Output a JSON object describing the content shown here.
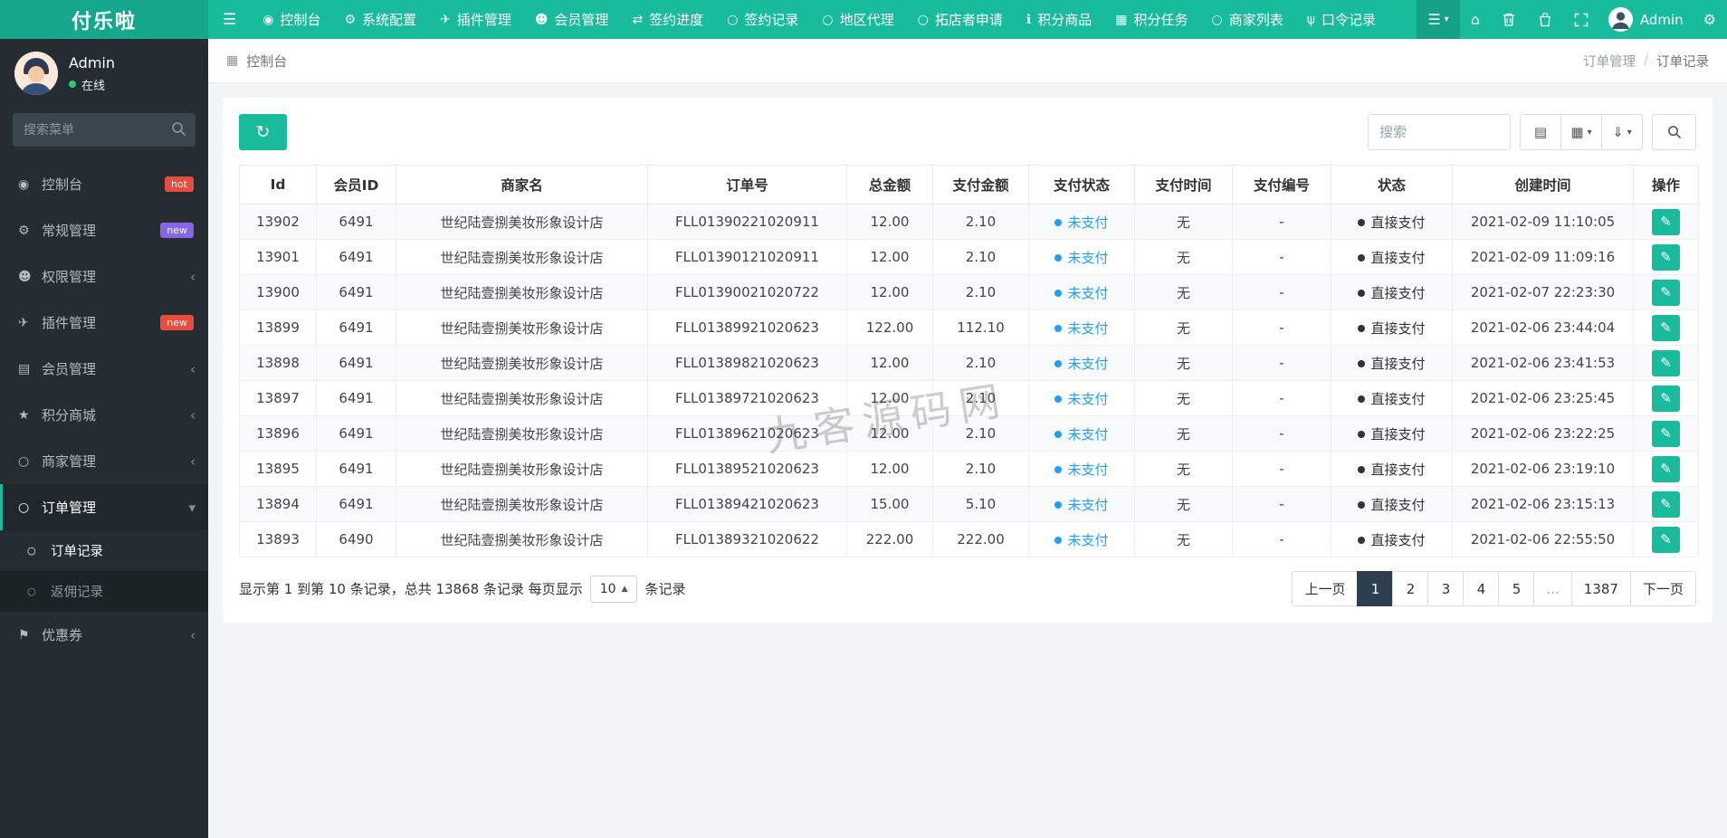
{
  "brand": {
    "logo": "付乐啦"
  },
  "colors": {
    "accent": "#18bc9c",
    "pay_status_blue": "#1e9fff",
    "status_dark": "#333333",
    "pagination_active": "#2c3e50",
    "badge_red": "#e74c3c",
    "badge_purple": "#8566e8"
  },
  "topnav": {
    "items": [
      {
        "label": "控制台",
        "icon": "dashboard-icon"
      },
      {
        "label": "系统配置",
        "icon": "gear-icon"
      },
      {
        "label": "插件管理",
        "icon": "plane-icon"
      },
      {
        "label": "会员管理",
        "icon": "users-icon"
      },
      {
        "label": "签约进度",
        "icon": "arrows-icon"
      },
      {
        "label": "签约记录",
        "icon": "circle-icon"
      },
      {
        "label": "地区代理",
        "icon": "circle-icon"
      },
      {
        "label": "拓店者申请",
        "icon": "circle-icon"
      },
      {
        "label": "积分商品",
        "icon": "info-icon"
      },
      {
        "label": "积分任务",
        "icon": "grid-icon"
      },
      {
        "label": "商家列表",
        "icon": "circle-icon"
      },
      {
        "label": "口令记录",
        "icon": "fork-icon"
      }
    ],
    "user_name": "Admin"
  },
  "sidebar": {
    "user": {
      "name": "Admin",
      "status": "在线"
    },
    "search_placeholder": "搜索菜单",
    "items": [
      {
        "label": "控制台",
        "icon": "dashboard-icon",
        "badge": "hot",
        "badge_color": "#e74c3c"
      },
      {
        "label": "常规管理",
        "icon": "gear-icon",
        "badge": "new",
        "badge_color": "#8566e8"
      },
      {
        "label": "权限管理",
        "icon": "users-icon",
        "arrow": "collapsed"
      },
      {
        "label": "插件管理",
        "icon": "plane-icon",
        "badge": "new",
        "badge_color": "#e74c3c"
      },
      {
        "label": "会员管理",
        "icon": "list-icon",
        "arrow": "collapsed"
      },
      {
        "label": "积分商城",
        "icon": "star-icon",
        "arrow": "collapsed"
      },
      {
        "label": "商家管理",
        "icon": "circle-icon",
        "arrow": "collapsed"
      },
      {
        "label": "订单管理",
        "icon": "circle-icon",
        "arrow": "expanded",
        "active": true,
        "children": [
          {
            "label": "订单记录",
            "icon": "circle-icon",
            "active": true
          },
          {
            "label": "返佣记录",
            "icon": "circle-icon"
          }
        ]
      },
      {
        "label": "优惠券",
        "icon": "flag-icon",
        "arrow": "collapsed"
      }
    ]
  },
  "breadcrumb": {
    "section": "控制台",
    "trail": [
      "订单管理",
      "订单记录"
    ]
  },
  "toolbar": {
    "search_placeholder": "搜索"
  },
  "table": {
    "columns": [
      "Id",
      "会员ID",
      "商家名",
      "订单号",
      "总金额",
      "支付金额",
      "支付状态",
      "支付时间",
      "支付编号",
      "状态",
      "创建时间",
      "操作"
    ],
    "rows": [
      {
        "id": "13902",
        "member_id": "6491",
        "merchant": "世纪陆壹捌美妆形象设计店",
        "order_no": "FLL01390221020911",
        "total": "12.00",
        "paid": "2.10",
        "pay_status": "未支付",
        "pay_time": "无",
        "pay_no": "-",
        "status": "直接支付",
        "created": "2021-02-09 11:10:05"
      },
      {
        "id": "13901",
        "member_id": "6491",
        "merchant": "世纪陆壹捌美妆形象设计店",
        "order_no": "FLL01390121020911",
        "total": "12.00",
        "paid": "2.10",
        "pay_status": "未支付",
        "pay_time": "无",
        "pay_no": "-",
        "status": "直接支付",
        "created": "2021-02-09 11:09:16"
      },
      {
        "id": "13900",
        "member_id": "6491",
        "merchant": "世纪陆壹捌美妆形象设计店",
        "order_no": "FLL01390021020722",
        "total": "12.00",
        "paid": "2.10",
        "pay_status": "未支付",
        "pay_time": "无",
        "pay_no": "-",
        "status": "直接支付",
        "created": "2021-02-07 22:23:30"
      },
      {
        "id": "13899",
        "member_id": "6491",
        "merchant": "世纪陆壹捌美妆形象设计店",
        "order_no": "FLL01389921020623",
        "total": "122.00",
        "paid": "112.10",
        "pay_status": "未支付",
        "pay_time": "无",
        "pay_no": "-",
        "status": "直接支付",
        "created": "2021-02-06 23:44:04"
      },
      {
        "id": "13898",
        "member_id": "6491",
        "merchant": "世纪陆壹捌美妆形象设计店",
        "order_no": "FLL01389821020623",
        "total": "12.00",
        "paid": "2.10",
        "pay_status": "未支付",
        "pay_time": "无",
        "pay_no": "-",
        "status": "直接支付",
        "created": "2021-02-06 23:41:53"
      },
      {
        "id": "13897",
        "member_id": "6491",
        "merchant": "世纪陆壹捌美妆形象设计店",
        "order_no": "FLL01389721020623",
        "total": "12.00",
        "paid": "2.10",
        "pay_status": "未支付",
        "pay_time": "无",
        "pay_no": "-",
        "status": "直接支付",
        "created": "2021-02-06 23:25:45"
      },
      {
        "id": "13896",
        "member_id": "6491",
        "merchant": "世纪陆壹捌美妆形象设计店",
        "order_no": "FLL01389621020623",
        "total": "12.00",
        "paid": "2.10",
        "pay_status": "未支付",
        "pay_time": "无",
        "pay_no": "-",
        "status": "直接支付",
        "created": "2021-02-06 23:22:25"
      },
      {
        "id": "13895",
        "member_id": "6491",
        "merchant": "世纪陆壹捌美妆形象设计店",
        "order_no": "FLL01389521020623",
        "total": "12.00",
        "paid": "2.10",
        "pay_status": "未支付",
        "pay_time": "无",
        "pay_no": "-",
        "status": "直接支付",
        "created": "2021-02-06 23:19:10"
      },
      {
        "id": "13894",
        "member_id": "6491",
        "merchant": "世纪陆壹捌美妆形象设计店",
        "order_no": "FLL01389421020623",
        "total": "15.00",
        "paid": "5.10",
        "pay_status": "未支付",
        "pay_time": "无",
        "pay_no": "-",
        "status": "直接支付",
        "created": "2021-02-06 23:15:13"
      },
      {
        "id": "13893",
        "member_id": "6490",
        "merchant": "世纪陆壹捌美妆形象设计店",
        "order_no": "FLL01389321020622",
        "total": "222.00",
        "paid": "222.00",
        "pay_status": "未支付",
        "pay_time": "无",
        "pay_no": "-",
        "status": "直接支付",
        "created": "2021-02-06 22:55:50"
      }
    ]
  },
  "footer": {
    "summary_prefix": "显示第 1 到第 10 条记录，总共 13868 条记录 每页显示",
    "page_size": "10",
    "summary_suffix": "条记录"
  },
  "pagination": {
    "items": [
      "上一页",
      "1",
      "2",
      "3",
      "4",
      "5",
      "...",
      "1387",
      "下一页"
    ],
    "active": "1"
  },
  "watermark": {
    "text": "九客源码网"
  }
}
